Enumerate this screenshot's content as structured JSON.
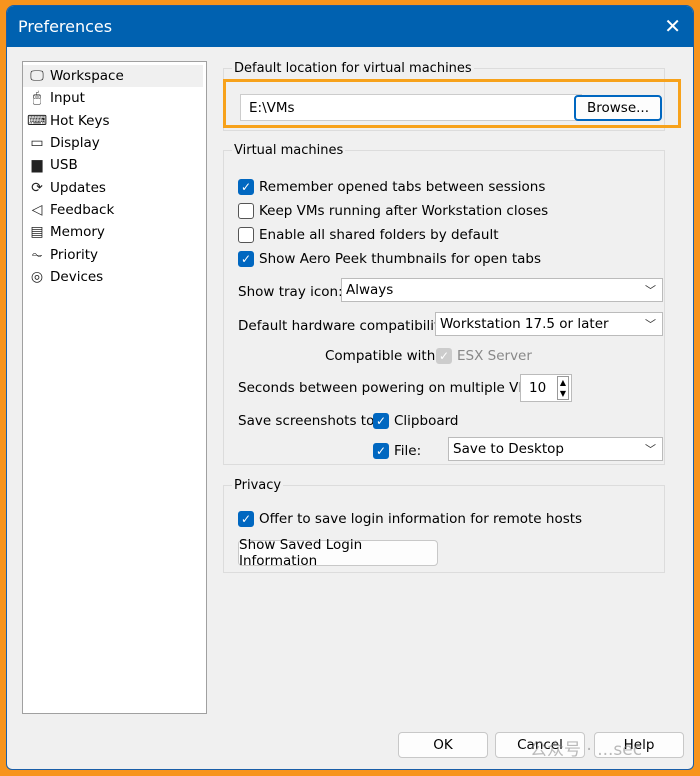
{
  "title": "Preferences",
  "sidebar": {
    "items": [
      {
        "label": "Workspace",
        "icon": "monitor-icon",
        "glyph": "🖵"
      },
      {
        "label": "Input",
        "icon": "mouse-icon",
        "glyph": "🖱"
      },
      {
        "label": "Hot Keys",
        "icon": "keyboard-icon",
        "glyph": "⌨"
      },
      {
        "label": "Display",
        "icon": "display-icon",
        "glyph": "▭"
      },
      {
        "label": "USB",
        "icon": "usb-icon",
        "glyph": "▆"
      },
      {
        "label": "Updates",
        "icon": "refresh-icon",
        "glyph": "⟳"
      },
      {
        "label": "Feedback",
        "icon": "megaphone-icon",
        "glyph": "◁"
      },
      {
        "label": "Memory",
        "icon": "memory-icon",
        "glyph": "▤"
      },
      {
        "label": "Priority",
        "icon": "pulse-icon",
        "glyph": "⏦"
      },
      {
        "label": "Devices",
        "icon": "disc-icon",
        "glyph": "◎"
      }
    ]
  },
  "location": {
    "legend": "Default location for virtual machines",
    "value": "E:\\VMs",
    "browse": "Browse..."
  },
  "vms": {
    "legend": "Virtual machines",
    "remember_tabs": "Remember opened tabs between sessions",
    "keep_running": "Keep VMs running after Workstation closes",
    "shared_folders": "Enable all shared folders by default",
    "aero_peek": "Show Aero Peek thumbnails for open tabs",
    "tray_label": "Show tray icon:",
    "tray_value": "Always",
    "hw_label": "Default hardware compatibility:",
    "hw_value": "Workstation 17.5 or later",
    "compat_label": "Compatible with:",
    "compat_value": "ESX Server",
    "seconds_label": "Seconds between powering on multiple VMs:",
    "seconds_value": "10",
    "screens_label": "Save screenshots to:",
    "clipboard": "Clipboard",
    "file": "File:",
    "file_value": "Save to Desktop"
  },
  "privacy": {
    "legend": "Privacy",
    "offer": "Offer to save login information for remote hosts",
    "show_saved": "Show Saved Login Information"
  },
  "footer": {
    "ok": "OK",
    "cancel": "Cancel",
    "help": "Help"
  },
  "watermark": "公众号 · ...sec"
}
